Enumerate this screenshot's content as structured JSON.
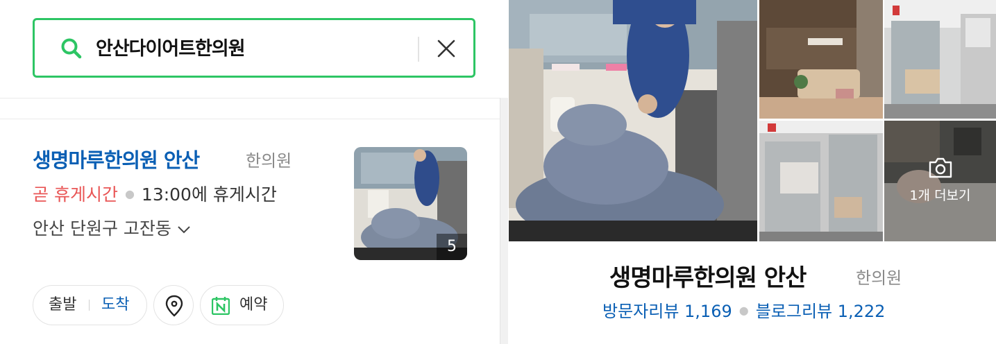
{
  "search": {
    "query": "안산다이어트한의원"
  },
  "result": {
    "name": "생명마루한의원 안산",
    "category": "한의원",
    "status": "곧 휴게시간",
    "status_detail": "13:00에 휴게시간",
    "address": "안산 단원구 고잔동",
    "photo_count": "5"
  },
  "actions": {
    "departure": "출발",
    "arrival": "도착",
    "reserve": "예약"
  },
  "detail": {
    "name": "생명마루한의원 안산",
    "category": "한의원",
    "more_photos": "1개 더보기",
    "visitor_reviews": "방문자리뷰 1,169",
    "blog_reviews": "블로그리뷰 1,222"
  },
  "colors": {
    "search_border": "#2dc564",
    "link_blue": "#0a5fb4",
    "status_red": "#e95555"
  }
}
